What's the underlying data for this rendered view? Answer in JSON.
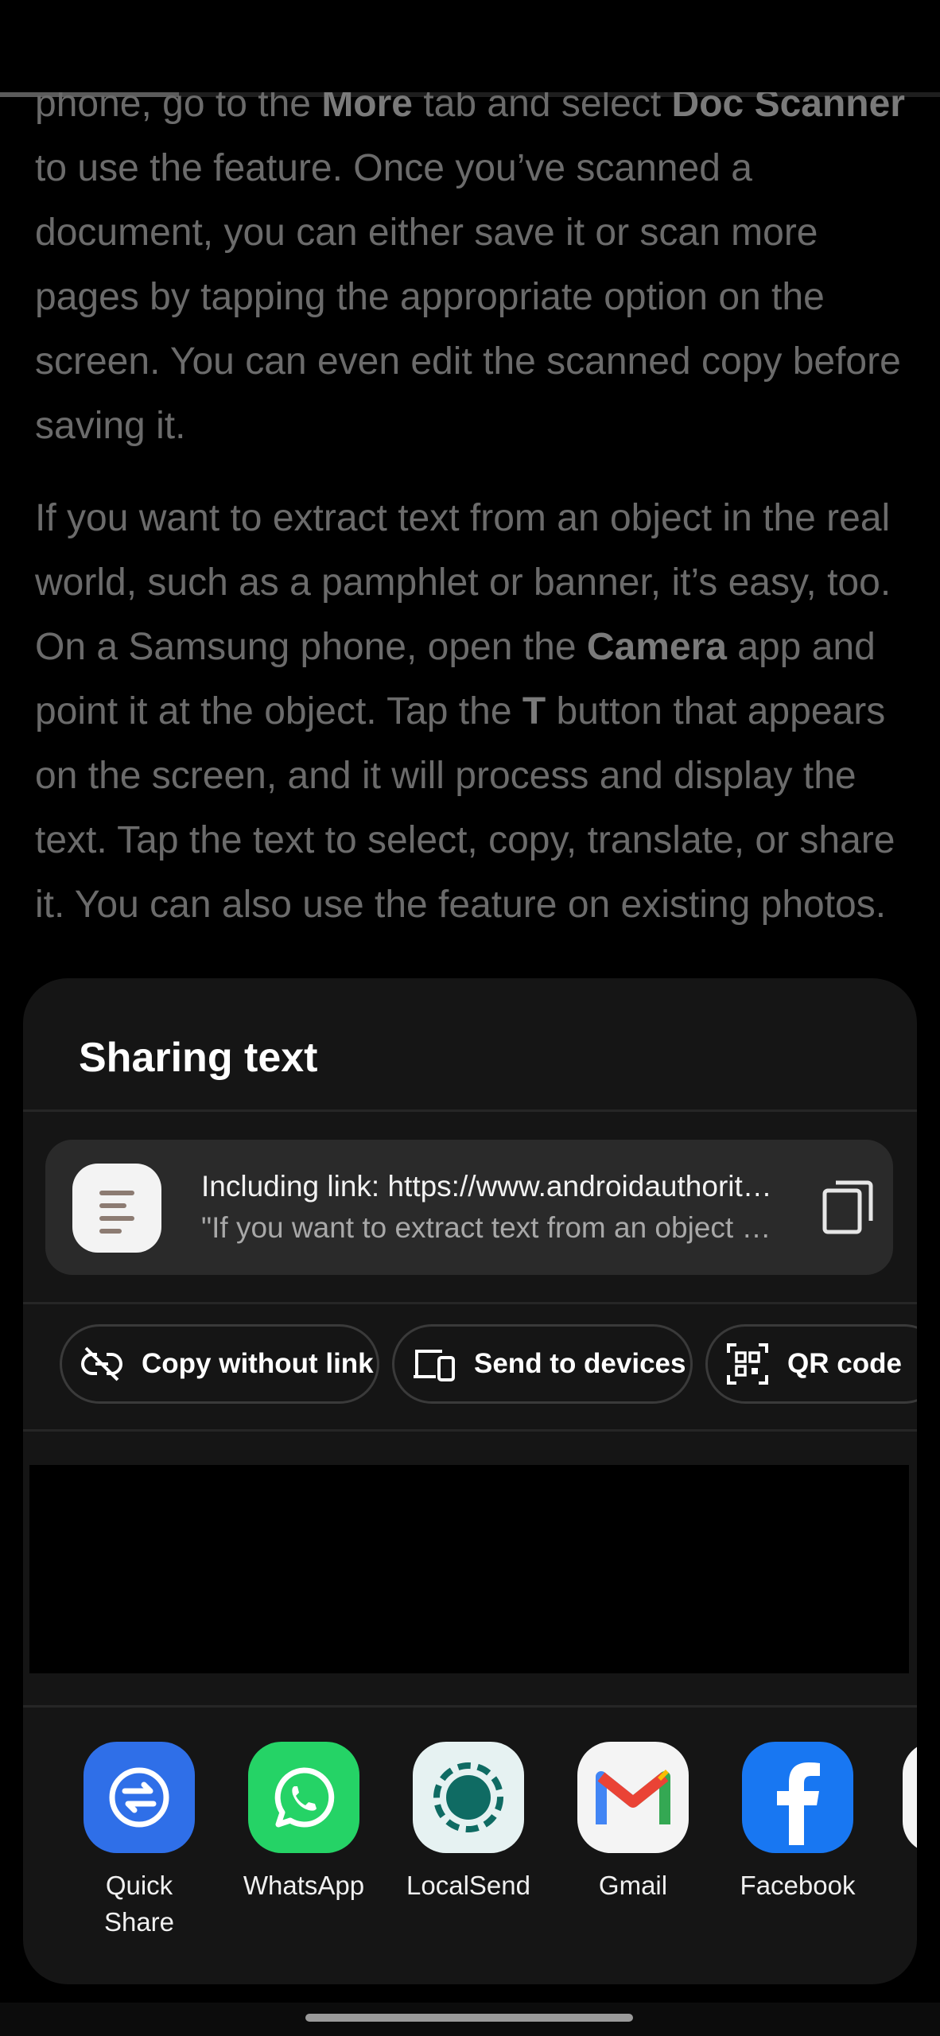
{
  "article": {
    "para1": [
      {
        "t": "phone, go to the "
      },
      {
        "t": "More",
        "b": true
      },
      {
        "t": " tab and select "
      },
      {
        "t": "Doc Scanner",
        "b": true
      },
      {
        "t": " to use the feature. Once you’ve scanned a document, you can either save it or scan more pages by tapping the appropriate option on the screen. You can even edit the scanned copy before saving it."
      }
    ],
    "para2": [
      {
        "t": "If you want to extract text from an object in the real world, such as a pamphlet or banner, it’s easy, too. On a Samsung phone, open the "
      },
      {
        "t": "Camera",
        "b": true
      },
      {
        "t": " app and point it at the object. Tap the "
      },
      {
        "t": "T",
        "b": true
      },
      {
        "t": " button that appears on the screen, and it will process and display the text. Tap the text to select, copy, translate, or share it. You can also use the feature on existing photos."
      }
    ],
    "read_progress": 0.19
  },
  "share_sheet": {
    "title": "Sharing text",
    "preview": {
      "line1": "Including link: https://www.androidauthority.com/",
      "line2": "\"If you want to extract text from an object in the real world\""
    },
    "actions": [
      {
        "label": "Copy without link",
        "icon": "link-off-icon"
      },
      {
        "label": "Send to devices",
        "icon": "devices-icon"
      },
      {
        "label": "QR code",
        "icon": "qr-code-icon"
      }
    ],
    "apps": [
      {
        "label": "Quick\nShare",
        "icon": "quick-share-icon",
        "color": "#2f6fe8"
      },
      {
        "label": "WhatsApp",
        "icon": "whatsapp-icon",
        "color": "#25d366"
      },
      {
        "label": "LocalSend",
        "icon": "localsend-icon",
        "color": "#e6f2f2"
      },
      {
        "label": "Gmail",
        "icon": "gmail-icon",
        "color": "#f4f4f4"
      },
      {
        "label": "Facebook",
        "icon": "facebook-icon",
        "color": "#1877f2"
      }
    ]
  }
}
